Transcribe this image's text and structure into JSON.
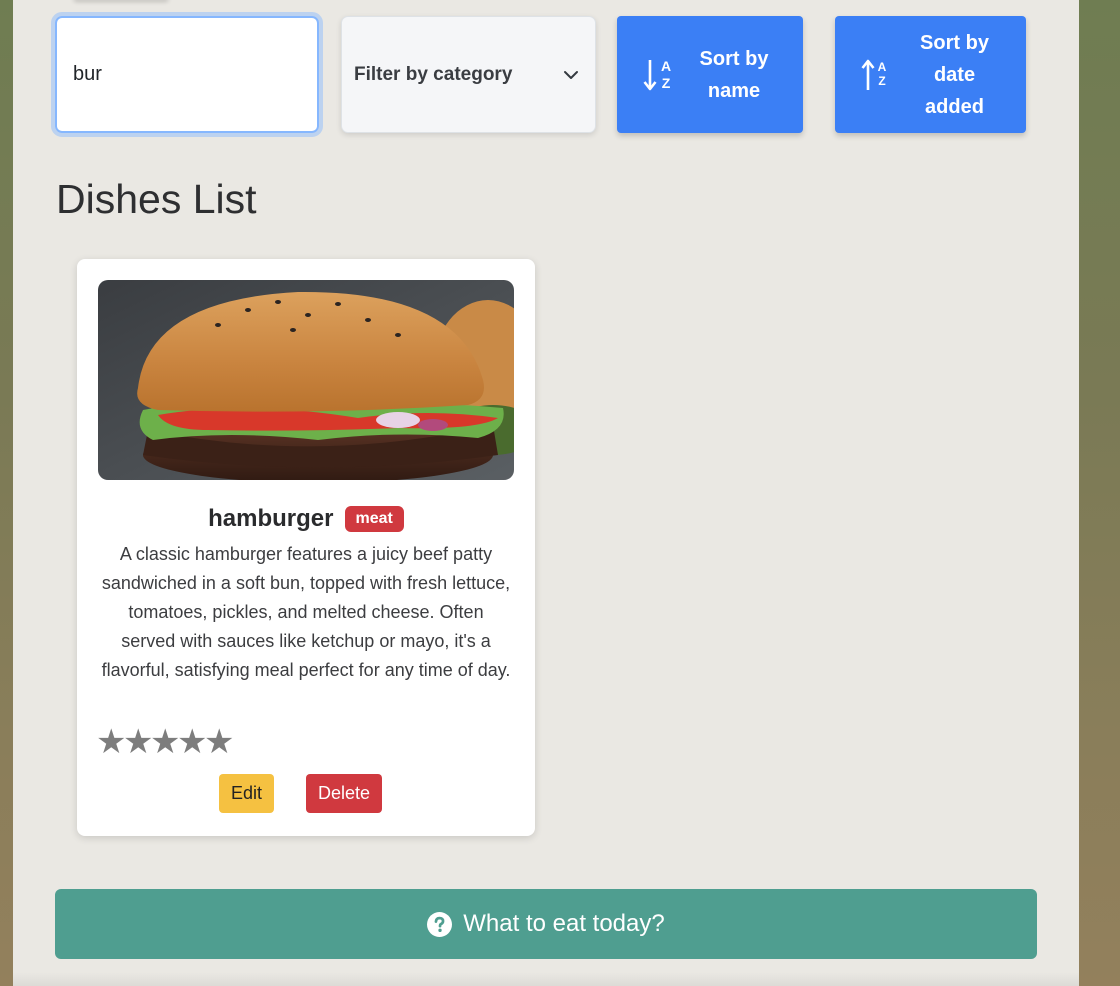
{
  "search": {
    "value": "bur",
    "placeholder": "Search"
  },
  "filter": {
    "label": "Filter by category",
    "icon": "chevron-down-icon"
  },
  "sort_buttons": [
    {
      "label": "Sort by\nname",
      "icon": "sort-alpha-down-icon"
    },
    {
      "label": "Sort by\ndate\nadded",
      "icon": "sort-alpha-up-icon"
    }
  ],
  "dishes_title": "Dishes List",
  "dishes": [
    {
      "name": "hamburger",
      "category": "meat",
      "description": "A classic hamburger features a juicy beef patty sandwiched in a soft bun, topped with fresh lettuce, tomatoes, pickles, and melted cheese. Often served with sauces like ketchup or mayo, it's a flavorful, satisfying meal perfect for any time of day.",
      "rating_stars": [
        "★",
        "★",
        "★",
        "★",
        "★"
      ],
      "edit_label": "Edit",
      "delete_label": "Delete"
    }
  ],
  "what_to_eat": {
    "label": "What to eat today?",
    "icon": "question-circle-icon"
  },
  "colors": {
    "primary": "#3b7ff5",
    "danger": "#d0393f",
    "warning": "#f5c141",
    "teal": "#4f9e90",
    "panel": "#eae8e3"
  }
}
